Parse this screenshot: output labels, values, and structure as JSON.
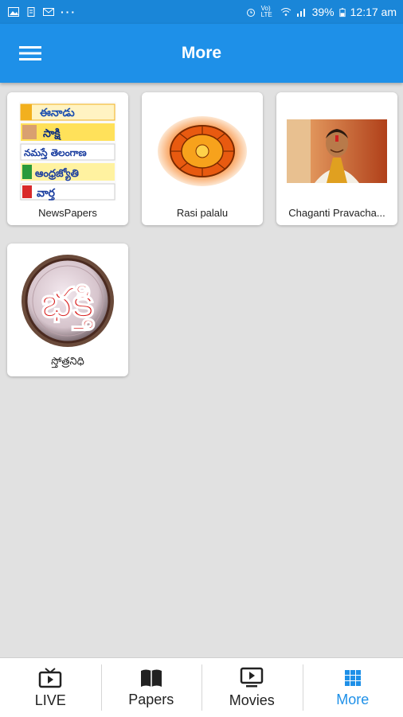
{
  "status_bar": {
    "battery": "39%",
    "time": "12:17 am",
    "network": "Vo) LTE"
  },
  "app_bar": {
    "title": "More",
    "menu_icon": "hamburger-menu-icon"
  },
  "tiles": [
    {
      "label": "NewsPapers",
      "icon": "newspapers-logos-image",
      "paper_names": [
        "ఈనాడు",
        "సాక్షి",
        "నమస్తే తెలంగాణ",
        "ఆంధ్రజ్యోతి",
        "వార్త"
      ]
    },
    {
      "label": "Rasi palalu",
      "icon": "zodiac-wheel-image"
    },
    {
      "label": "Chaganti Pravacha...",
      "icon": "speaker-portrait-image"
    },
    {
      "label": "స్తోత్రనిధి",
      "icon": "bhakti-logo-image",
      "art_text": "భక్తి"
    }
  ],
  "bottom_nav": {
    "items": [
      {
        "label": "LIVE",
        "icon": "live-tv-icon"
      },
      {
        "label": "Papers",
        "icon": "book-icon"
      },
      {
        "label": "Movies",
        "icon": "movie-screen-icon"
      },
      {
        "label": "More",
        "icon": "grid-icon"
      }
    ],
    "active": "More"
  },
  "colors": {
    "primary": "#1e90e8",
    "status_bar": "#1a86d8",
    "background": "#e1e1e1"
  }
}
